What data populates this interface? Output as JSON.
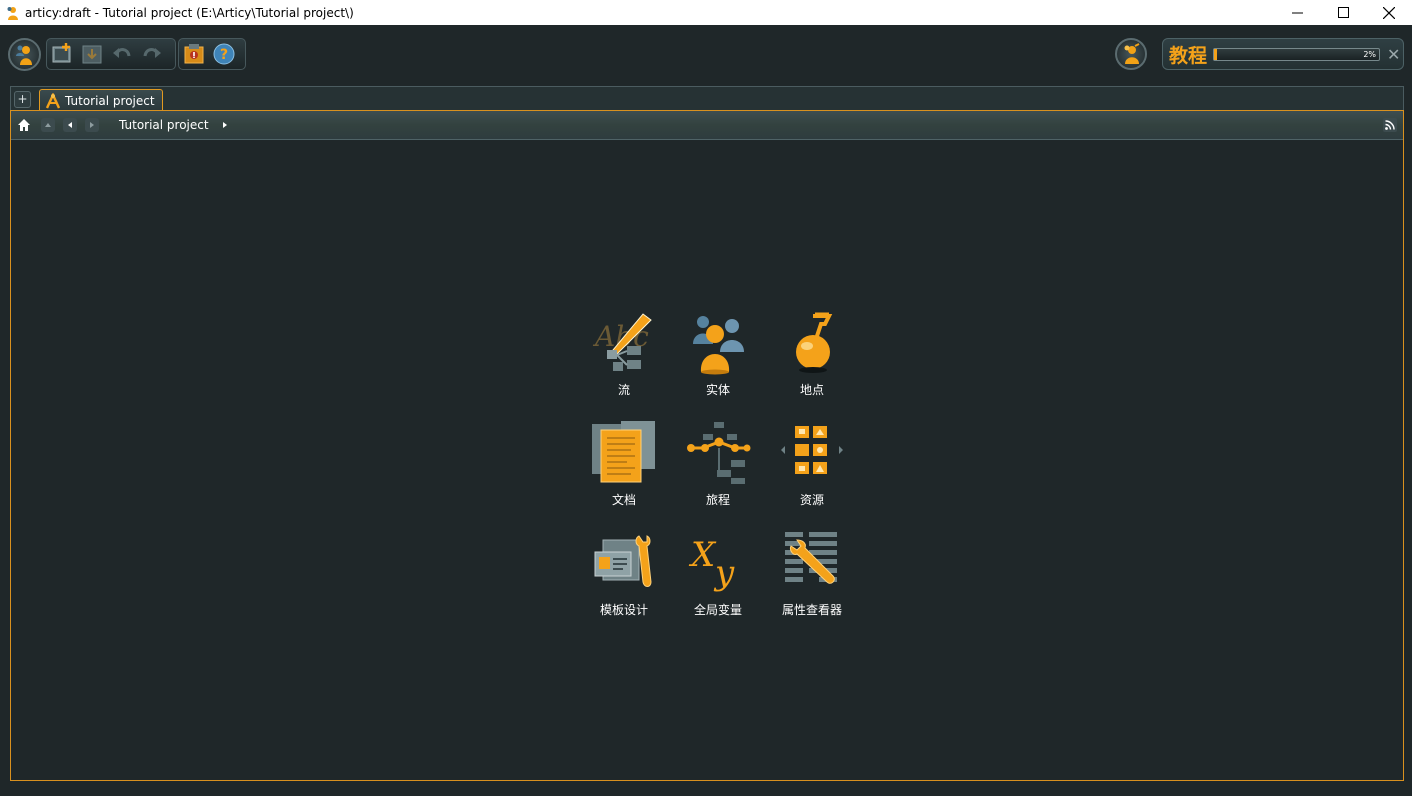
{
  "window": {
    "title": "articy:draft - Tutorial project (E:\\Articy\\Tutorial project\\)",
    "controls": {
      "minimize": "—",
      "maximize": "☐",
      "close": "✕"
    }
  },
  "toolbar": {
    "buttons": [
      "new-icon",
      "save-icon",
      "undo-icon",
      "redo-icon",
      "report-icon",
      "help-icon"
    ]
  },
  "tutorial": {
    "label": "教程",
    "progress_percent": 2,
    "progress_text": "2%",
    "close": "✕"
  },
  "tabs": {
    "add": "+",
    "items": [
      {
        "label": "Tutorial project"
      }
    ]
  },
  "navbar": {
    "breadcrumb": "Tutorial project"
  },
  "launcher": {
    "tiles": [
      {
        "label": "流",
        "icon": "flow-icon"
      },
      {
        "label": "实体",
        "icon": "entities-icon"
      },
      {
        "label": "地点",
        "icon": "locations-icon"
      },
      {
        "label": "文档",
        "icon": "documents-icon"
      },
      {
        "label": "旅程",
        "icon": "journeys-icon"
      },
      {
        "label": "资源",
        "icon": "assets-icon"
      },
      {
        "label": "模板设计",
        "icon": "template-design-icon"
      },
      {
        "label": "全局变量",
        "icon": "global-variables-icon"
      },
      {
        "label": "属性查看器",
        "icon": "property-inspector-icon"
      }
    ]
  },
  "colors": {
    "accent": "#f4a21a",
    "background": "#1f2729",
    "frame_border": "#d9911f"
  }
}
